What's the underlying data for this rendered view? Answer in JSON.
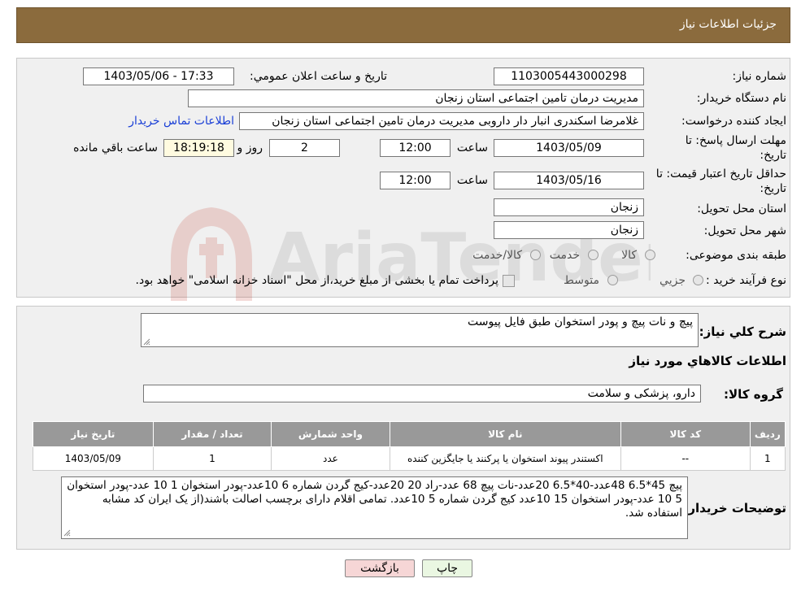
{
  "header": {
    "title": "جزئیات اطلاعات نیاز"
  },
  "form": {
    "need_number_label": "شماره نیاز:",
    "need_number": "1103005443000298",
    "announce_label": "تاریخ و ساعت اعلان عمومي:",
    "announce_value": "1403/05/06 - 17:33",
    "buyer_org_label": "نام دستگاه خريدار:",
    "buyer_org": "مدیریت درمان تامین اجتماعی استان زنجان",
    "requester_label": "ايجاد کننده درخواست:",
    "requester": "غلامرضا  اسکندری انبار دار داروبی مدیریت درمان تامین اجتماعی استان زنجان",
    "contact_link": "اطلاعات تماس خريدار",
    "deadline_label_1": "مهلت ارسال پاسخ: تا",
    "deadline_label_2": "تاريخ:",
    "deadline_date": "1403/05/09",
    "hour_label": "ساعت",
    "deadline_time": "12:00",
    "days_value": "2",
    "days_label": "روز و",
    "remaining_time": "18:19:18",
    "remaining_label": "ساعت باقي مانده",
    "validity_label_1": "حداقل تاريخ اعتبار قيمت: تا",
    "validity_label_2": "تاريخ:",
    "validity_date": "1403/05/16",
    "validity_hour_label": "ساعت",
    "validity_time": "12:00",
    "province_label": "استان محل تحويل:",
    "province": "زنجان",
    "city_label": "شهر محل تحويل:",
    "city": "زنجان",
    "category_label": "طبقه بندی موضوعی:",
    "category_options": [
      "کالا",
      "خدمت",
      "کالا/خدمت"
    ],
    "purchase_type_label": "نوع فرآيند خريد :",
    "purchase_options": [
      "جزيي",
      "متوسط"
    ],
    "purchase_note": "پرداخت تمام يا بخشی از مبلغ خريد،از محل \"اسناد خزانه اسلامی\" خواهد بود."
  },
  "details": {
    "summary_label": "شرح کلي نياز:",
    "summary": "پیچ و نات پیچ و پودر استخوان طبق فایل پیوست",
    "goods_info_title": "اطلاعات کالاهاي مورد نياز",
    "goods_group_label": "گروه کالا:",
    "goods_group": "دارو، پزشکی و سلامت",
    "table": {
      "headers": [
        "رديف",
        "کد کالا",
        "نام کالا",
        "واحد شمارش",
        "تعداد / مقدار",
        "تاريخ نياز"
      ],
      "rows": [
        [
          "1",
          "--",
          "اکستندر پیوند استخوان یا پرکنند یا جایگزین کننده",
          "عدد",
          "1",
          "1403/05/09"
        ]
      ]
    },
    "buyer_notes_label": "توضيحات خريدار:",
    "buyer_notes": "پیچ 45*6.5 48عدد-40*6.5 20عدد-نات پیچ 68 عدد-راد 20 20عدد-کیج گردن شماره 6 10عدد-پودر استخوان 1 10 عدد-پودر استخوان 5 10 عدد-پودر استخوان 15 10عدد کیج گردن شماره 5 10عدد. تمامی اقلام دارای برچسب اصالت باشند(از یک ایران کد مشابه استفاده شد."
  },
  "buttons": {
    "print": "چاپ",
    "back": "بازگشت"
  },
  "watermark": {
    "text": "AriaTender.neT"
  },
  "colors": {
    "header_bg": "#8b6b3d",
    "panel_bg": "#f0f0f0",
    "table_header_bg": "#999999",
    "link": "#1a3fd6",
    "back_button_bg": "#f6d6d6",
    "print_button_bg": "#eaf7e2",
    "timer_bg": "#fffbe0"
  }
}
